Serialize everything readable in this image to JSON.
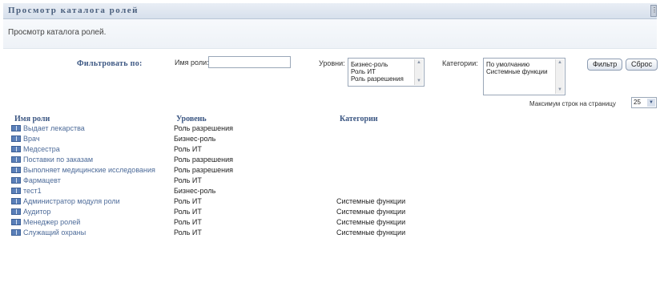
{
  "header": {
    "title": "Просмотр каталога ролей"
  },
  "description": "Просмотр каталога ролей.",
  "filter": {
    "label": "Фильтровать по:",
    "role_name_label": "Имя роли:",
    "role_name_value": "",
    "levels_label": "Уровни:",
    "levels_options": [
      "Бизнес-роль",
      "Роль ИТ",
      "Роль разрешения"
    ],
    "categories_label": "Категории:",
    "categories_options": [
      "По умолчанию",
      "Системные функции"
    ],
    "filter_button": "Фильтр",
    "reset_button": "Сброс"
  },
  "max_rows": {
    "label": "Максимум строк на страницу",
    "value": "25"
  },
  "table": {
    "headers": {
      "role_name": "Имя роли",
      "level": "Уровень",
      "categories": "Категории"
    },
    "rows": [
      {
        "name": "Выдает лекарства",
        "level": "Роль разрешения",
        "category": ""
      },
      {
        "name": "Врач",
        "level": "Бизнес-роль",
        "category": ""
      },
      {
        "name": "Медсестра",
        "level": "Роль ИТ",
        "category": ""
      },
      {
        "name": "Поставки по заказам",
        "level": "Роль разрешения",
        "category": ""
      },
      {
        "name": "Выполняет медицинские исследования",
        "level": "Роль разрешения",
        "category": ""
      },
      {
        "name": "Фармацевт",
        "level": "Роль ИТ",
        "category": ""
      },
      {
        "name": "тест1",
        "level": "Бизнес-роль",
        "category": ""
      },
      {
        "name": "Администратор модуля роли",
        "level": "Роль ИТ",
        "category": "Системные функции"
      },
      {
        "name": "Аудитор",
        "level": "Роль ИТ",
        "category": "Системные функции"
      },
      {
        "name": "Менеджер ролей",
        "level": "Роль ИТ",
        "category": "Системные функции"
      },
      {
        "name": "Служащий охраны",
        "level": "Роль ИТ",
        "category": "Системные функции"
      }
    ]
  }
}
